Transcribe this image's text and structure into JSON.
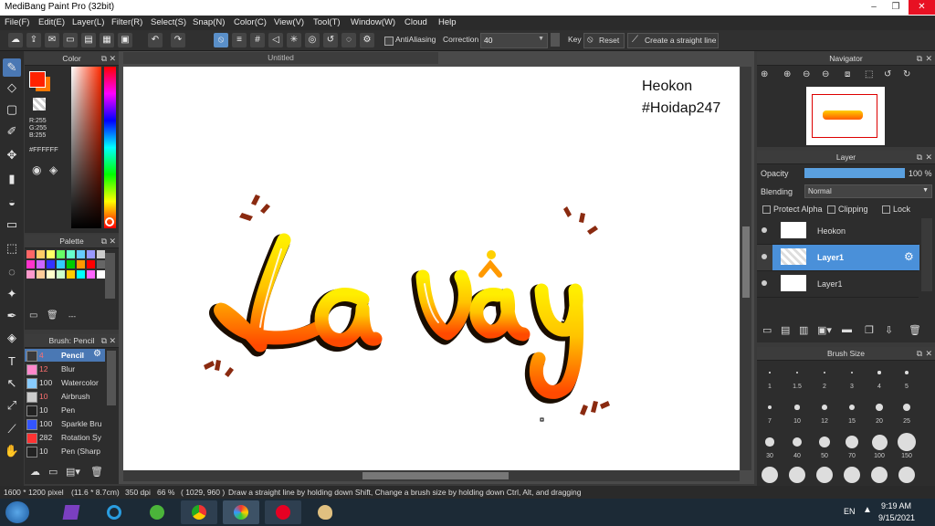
{
  "title_bar": {
    "title": "MediBang Paint Pro (32bit)"
  },
  "menu": [
    "File(F)",
    "Edit(E)",
    "Layer(L)",
    "Filter(R)",
    "Select(S)",
    "Snap(N)",
    "Color(C)",
    "View(V)",
    "Tool(T)",
    "Window(W)",
    "Cloud",
    "Help"
  ],
  "toolbar": {
    "antialiasing_label": "AntiAliasing",
    "correction_label": "Correction",
    "correction_value": "40",
    "key_label": "Key",
    "reset_label": "Reset",
    "straight_line_label": "Create a straight line"
  },
  "color_panel": {
    "title": "Color",
    "r": "R:255",
    "g": "G:255",
    "b": "B:255",
    "hex": "#FFFFFF",
    "fg_color": "#ff2200",
    "bg_color": "#ffffff"
  },
  "palette_panel": {
    "title": "Palette",
    "swatches": [
      "#ff6666",
      "#ffcc66",
      "#ffff66",
      "#66ff66",
      "#66ffcc",
      "#66ccff",
      "#9999ff",
      "#cccccc",
      "#ff33cc",
      "#cc66ff",
      "#3333ff",
      "#33ccff",
      "#00cc00",
      "#ff9900",
      "#ff0000",
      "#666666",
      "#ff99cc",
      "#ffcc99",
      "#ffffcc",
      "#ccffcc",
      "#ffcc00",
      "#00ffff",
      "#ff66ff",
      "#ffffff"
    ],
    "dash": "---"
  },
  "brush_panel": {
    "title": "Brush: Pencil",
    "items": [
      {
        "size": "4",
        "name": "Pencil",
        "color": "#3a3a3a"
      },
      {
        "size": "12",
        "name": "Blur",
        "color": "#ff88cc"
      },
      {
        "size": "100",
        "name": "Watercolor",
        "color": "#88ccff"
      },
      {
        "size": "10",
        "name": "Airbrush",
        "color": "#cccccc"
      },
      {
        "size": "10",
        "name": "Pen",
        "color": "#222222"
      },
      {
        "size": "100",
        "name": "Sparkle Bru",
        "color": "#3355ff"
      },
      {
        "size": "282",
        "name": "Rotation Sy",
        "color": "#ff3333"
      },
      {
        "size": "10",
        "name": "Pen (Sharp",
        "color": "#222222"
      }
    ]
  },
  "document": {
    "tab_title": "Untitled"
  },
  "canvas_text": {
    "line1": "Heokon",
    "line2": "#Hoidap247",
    "lettering": "La vậy"
  },
  "navigator": {
    "title": "Navigator"
  },
  "layer_panel": {
    "title": "Layer",
    "opacity_label": "Opacity",
    "opacity_value": "100 %",
    "opacity_fraction": 1.0,
    "blending_label": "Blending",
    "blending_value": "Normal",
    "protect_alpha": "Protect Alpha",
    "clipping": "Clipping",
    "lock": "Lock",
    "layers": [
      {
        "name": "Heokon",
        "selected": false
      },
      {
        "name": "Layer1",
        "selected": true
      },
      {
        "name": "Layer1",
        "selected": false
      }
    ]
  },
  "brush_size_panel": {
    "title": "Brush Size",
    "labels": [
      "1",
      "1.5",
      "2",
      "3",
      "4",
      "5",
      "7",
      "10",
      "12",
      "15",
      "20",
      "25",
      "30",
      "40",
      "50",
      "70",
      "100",
      "150"
    ]
  },
  "status_bar": {
    "dimensions": "1600 * 1200 pixel",
    "physical": "(11.6 * 8.7cm)",
    "dpi": "350 dpi",
    "zoom": "66 %",
    "cursor": "( 1029, 960 )",
    "hint": "Draw a straight line by holding down Shift, Change a brush size by holding down Ctrl, Alt, and dragging"
  },
  "taskbar": {
    "lang": "EN",
    "time": "9:19 AM",
    "date": "9/15/2021"
  }
}
